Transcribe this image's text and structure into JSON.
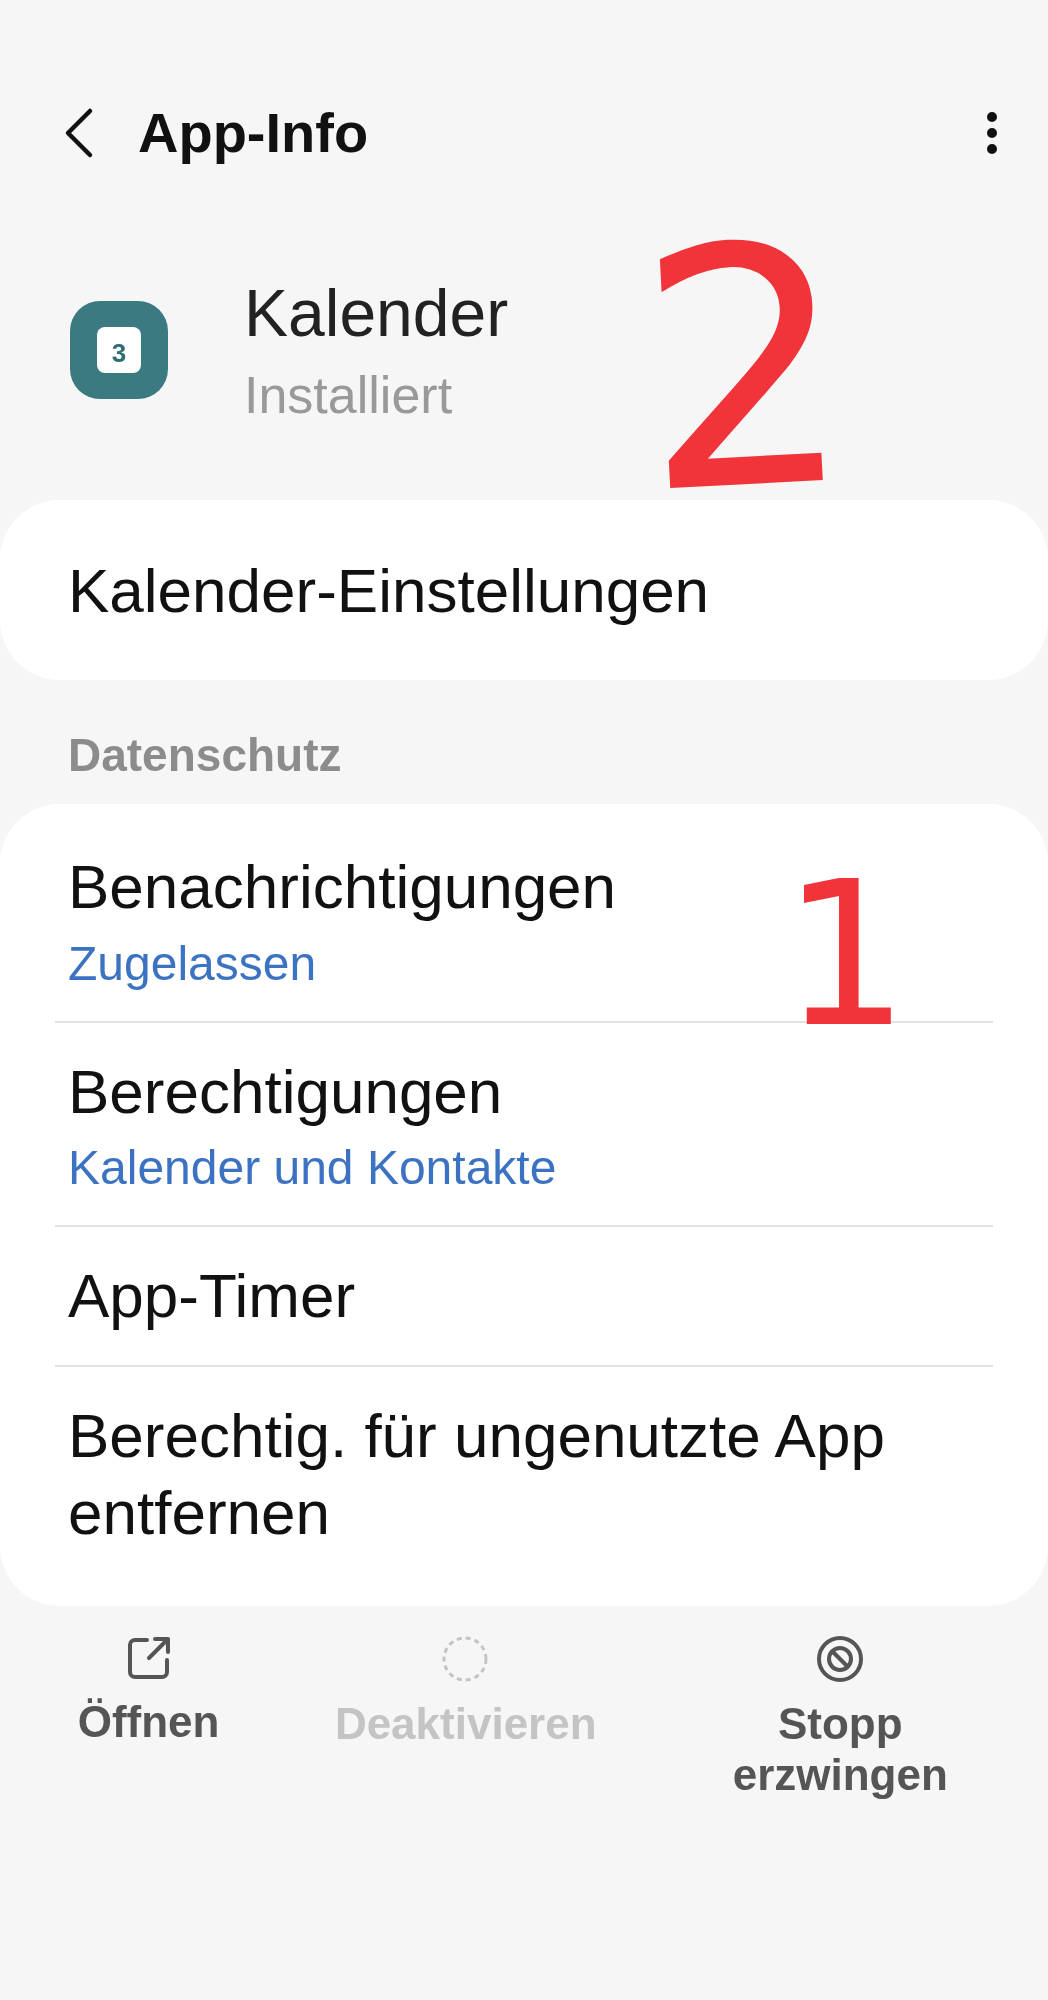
{
  "header": {
    "title": "App-Info"
  },
  "app": {
    "name": "Kalender",
    "status": "Installiert",
    "icon_text": "3"
  },
  "settings_item": {
    "label": "Kalender-Einstellungen"
  },
  "section": {
    "title": "Datenschutz"
  },
  "items": [
    {
      "label": "Benachrichtigungen",
      "value": "Zugelassen"
    },
    {
      "label": "Berechtigungen",
      "value": "Kalender und Kontakte"
    },
    {
      "label": "App-Timer"
    },
    {
      "label": "Berechtig. für ungenutzte App entfernen"
    }
  ],
  "actions": [
    {
      "kind": "open",
      "label": "Öffnen",
      "disabled": false
    },
    {
      "kind": "disable",
      "label": "Deaktivieren",
      "disabled": true
    },
    {
      "kind": "stop",
      "label": "Stopp erzwingen",
      "disabled": false
    }
  ],
  "annotations": [
    {
      "text": "2"
    },
    {
      "text": "1"
    }
  ]
}
